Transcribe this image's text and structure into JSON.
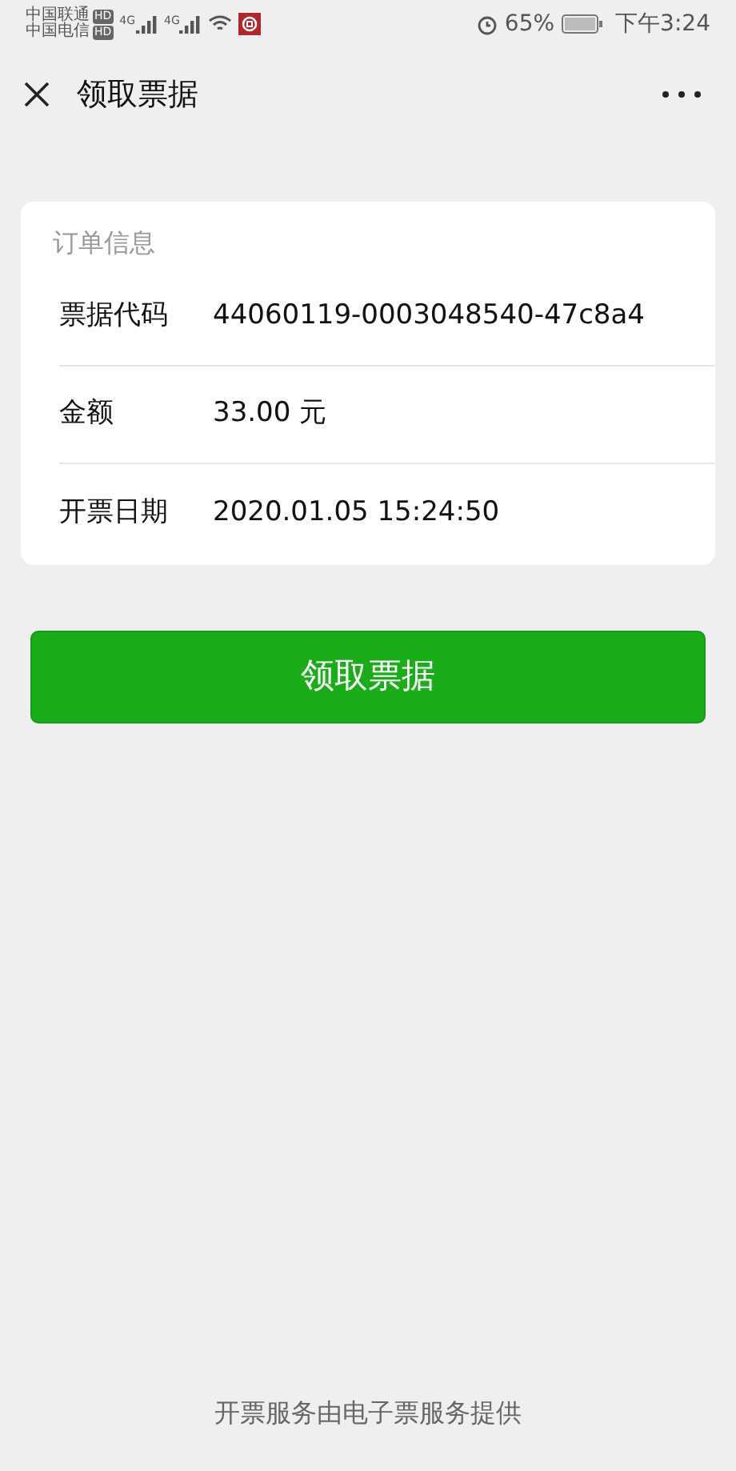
{
  "status_bar": {
    "carriers": [
      {
        "name": "中国联通",
        "badge": "HD"
      },
      {
        "name": "中国电信",
        "badge": "HD"
      }
    ],
    "networks": [
      "4G",
      "4G"
    ],
    "battery_percent": "65%",
    "time": "下午3:24"
  },
  "nav_bar": {
    "title": "领取票据"
  },
  "order_card": {
    "heading": "订单信息",
    "rows": [
      {
        "label": "票据代码",
        "value": "44060119-0003048540-47c8a4"
      },
      {
        "label": "金额",
        "value": "33.00 元"
      },
      {
        "label": "开票日期",
        "value": "2020.01.05 15:24:50"
      }
    ]
  },
  "primary_button": {
    "label": "领取票据"
  },
  "footer": "开票服务由电子票服务提供"
}
